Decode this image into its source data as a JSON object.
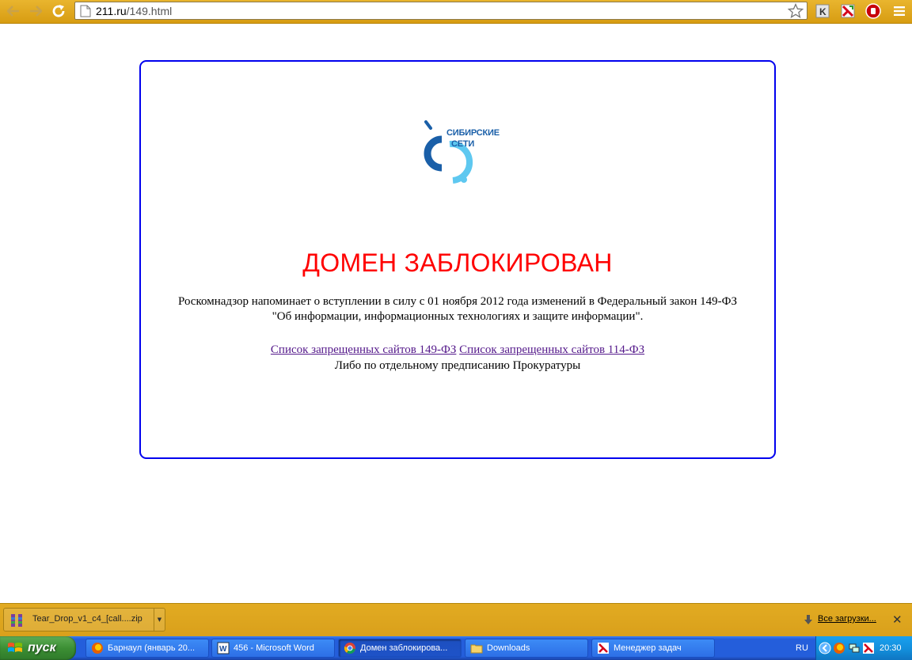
{
  "browser": {
    "url_host": "211.ru",
    "url_path": "/149.html"
  },
  "page": {
    "logo": {
      "line1": "СИБИРСКИЕ",
      "line2": "СЕТИ",
      "brand_color": "#1a5fa8",
      "accent_color": "#5ec8f0"
    },
    "headline": "ДОМЕН ЗАБЛОКИРОВАН",
    "notice_line1": "Роскомнадзор напоминает о вступлении в силу с 01 ноября 2012 года изменений в Федеральный закон 149-ФЗ",
    "notice_line2": "\"Об информации, информационных технологиях и защите информации\".",
    "link_149": "Список запрещенных сайтов 149-ФЗ",
    "link_114": "Список запрещенных сайтов 114-ФЗ",
    "prosecutor_note": "Либо по отдельному предписанию Прокуратуры",
    "headline_color": "#ff0000",
    "border_color": "#0000ee"
  },
  "download_shelf": {
    "file_name": "Tear_Drop_v1_c4_[call....zip",
    "all_downloads": "Все загрузки..."
  },
  "taskbar": {
    "start_label": "пуск",
    "tasks": [
      {
        "label": "Барнаул (январь 20...",
        "icon": "firefox-icon"
      },
      {
        "label": "456 - Microsoft Word",
        "icon": "word-icon"
      },
      {
        "label": "Домен заблокирова...",
        "icon": "chrome-icon"
      },
      {
        "label": "Downloads",
        "icon": "folder-icon"
      },
      {
        "label": "Менеджер задач",
        "icon": "task-manager-icon"
      }
    ],
    "language": "RU",
    "clock": "20:30"
  }
}
